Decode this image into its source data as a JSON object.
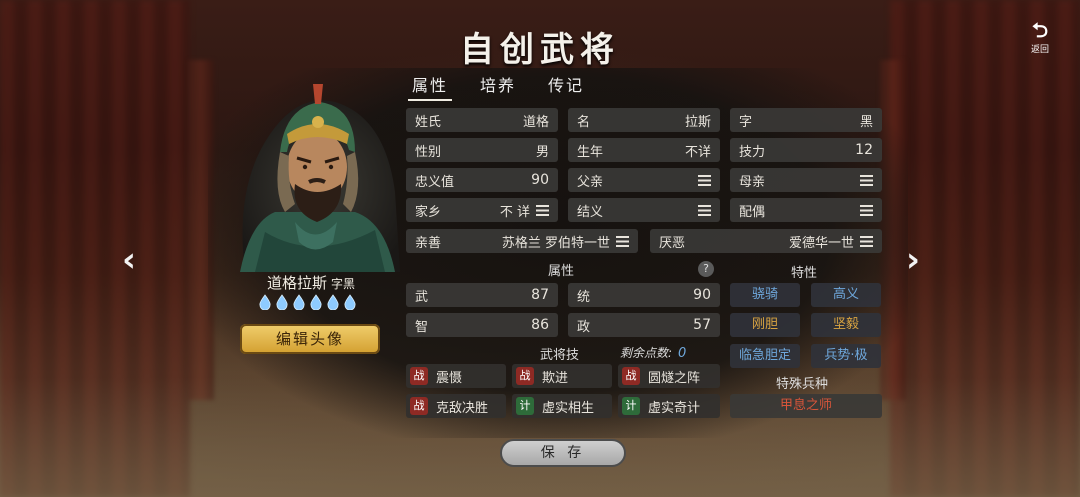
{
  "title": "自创武将",
  "back": {
    "label": "返回"
  },
  "tabs": [
    {
      "label": "属性",
      "active": true
    },
    {
      "label": "培养",
      "active": false
    },
    {
      "label": "传记",
      "active": false
    }
  ],
  "character": {
    "name": "道格拉斯",
    "courtesy_label": "字黑",
    "spirit_drops": 6,
    "edit_avatar_label": "编辑头像"
  },
  "info_fields": {
    "surname": {
      "label": "姓氏",
      "value": "道格"
    },
    "given_name": {
      "label": "名",
      "value": "拉斯"
    },
    "courtesy": {
      "label": "字",
      "value": "黑"
    },
    "gender": {
      "label": "性别",
      "value": "男"
    },
    "birth_year": {
      "label": "生年",
      "value": "不详"
    },
    "skill_power": {
      "label": "技力",
      "value": "12"
    },
    "loyalty": {
      "label": "忠义值",
      "value": "90"
    },
    "father": {
      "label": "父亲",
      "value": ""
    },
    "mother": {
      "label": "母亲",
      "value": ""
    },
    "hometown": {
      "label": "家乡",
      "value": "不 详"
    },
    "sworn": {
      "label": "结义",
      "value": ""
    },
    "spouse": {
      "label": "配偶",
      "value": ""
    },
    "likes": {
      "label": "亲善",
      "value": "苏格兰 罗伯特一世"
    },
    "dislikes": {
      "label": "厌恶",
      "value": "爱德华一世"
    }
  },
  "attributes": {
    "heading": "属性",
    "help": "?",
    "war": {
      "label": "武",
      "value": "87"
    },
    "command": {
      "label": "统",
      "value": "90"
    },
    "intel": {
      "label": "智",
      "value": "86"
    },
    "politics": {
      "label": "政",
      "value": "57"
    }
  },
  "traits": {
    "heading": "特性",
    "items": [
      {
        "label": "骁骑",
        "color": "#6fa8dc"
      },
      {
        "label": "高义",
        "color": "#6fa8dc"
      },
      {
        "label": "刚胆",
        "color": "#d9a441"
      },
      {
        "label": "坚毅",
        "color": "#d9a441"
      },
      {
        "label": "临急胆定",
        "color": "#6fa8dc"
      },
      {
        "label": "兵势·极",
        "color": "#6fa8dc"
      }
    ]
  },
  "skills": {
    "heading": "武将技",
    "points_label": "剩余点数:",
    "points_value": "0",
    "items": [
      {
        "type": "战",
        "label": "震慑"
      },
      {
        "type": "战",
        "label": "欺进"
      },
      {
        "type": "战",
        "label": "圆燧之阵"
      },
      {
        "type": "战",
        "label": "克敌决胜"
      },
      {
        "type": "计",
        "label": "虚实相生"
      },
      {
        "type": "计",
        "label": "虚实奇计"
      }
    ]
  },
  "special_troop": {
    "heading": "特殊兵种",
    "value": "甲息之师",
    "color": "#d8553a"
  },
  "save_label": "保 存",
  "colors": {
    "accent_gold": "#d9a441",
    "accent_blue": "#6fa8dc",
    "accent_red": "#d8553a"
  }
}
